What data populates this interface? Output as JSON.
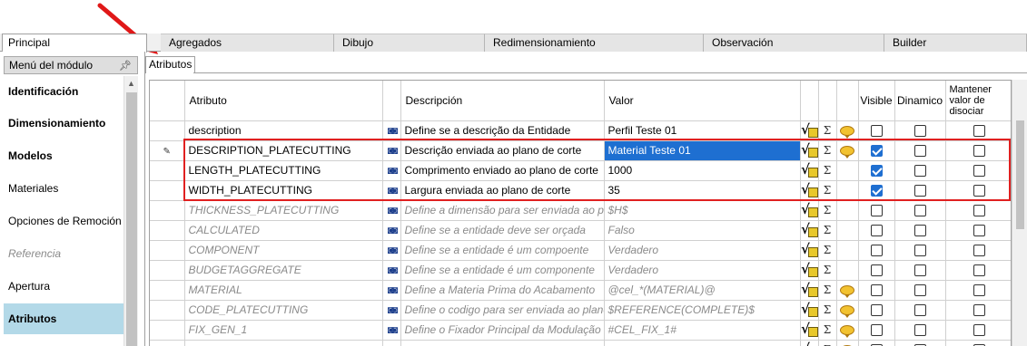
{
  "tabs": [
    {
      "label": "Principal",
      "active": true
    },
    {
      "label": "Agregados"
    },
    {
      "label": "Dibujo"
    },
    {
      "label": "Redimensionamiento"
    },
    {
      "label": "Observación"
    },
    {
      "label": "Builder"
    }
  ],
  "module_menu": {
    "header": "Menú del módulo",
    "items": [
      {
        "label": "Identificación",
        "style": "bold"
      },
      {
        "label": "Dimensionamiento",
        "style": "bold"
      },
      {
        "label": "Modelos",
        "style": "bold"
      },
      {
        "label": "Materiales",
        "style": "normal"
      },
      {
        "label": "Opciones de Remoción",
        "style": "normal"
      },
      {
        "label": "Referencia",
        "style": "disabled"
      },
      {
        "label": "Apertura",
        "style": "normal"
      },
      {
        "label": "Atributos",
        "style": "selected"
      }
    ]
  },
  "subtab": {
    "label": "Atributos"
  },
  "grid": {
    "columns": {
      "atributo": "Atributo",
      "descripcion": "Descripción",
      "valor": "Valor",
      "visible": "Visible",
      "dinamico": "Dinamico",
      "mantener": "Mantener valor de disociar"
    },
    "rows": [
      {
        "atributo": "description",
        "descripcion": "Define se a descrição da Entidade",
        "valor": "Perfil Teste 01",
        "visible": false,
        "dinamico": false,
        "mantener": false,
        "comment": true,
        "inherited": false,
        "editing": false
      },
      {
        "atributo": "DESCRIPTION_PLATECUTTING",
        "descripcion": "Descrição enviada ao plano de corte",
        "valor": "Material Teste 01",
        "visible": true,
        "dinamico": false,
        "mantener": false,
        "comment": true,
        "inherited": false,
        "editing": true
      },
      {
        "atributo": "LENGTH_PLATECUTTING",
        "descripcion": "Comprimento enviado ao plano de corte",
        "valor": "1000",
        "visible": true,
        "dinamico": false,
        "mantener": false,
        "comment": false,
        "inherited": false,
        "editing": false
      },
      {
        "atributo": "WIDTH_PLATECUTTING",
        "descripcion": "Largura enviada ao plano de corte",
        "valor": "35",
        "visible": true,
        "dinamico": false,
        "mantener": false,
        "comment": false,
        "inherited": false,
        "editing": false
      },
      {
        "atributo": "THICKNESS_PLATECUTTING",
        "descripcion": "Define a dimensão para ser enviada ao plan",
        "valor": "$H$",
        "visible": false,
        "dinamico": false,
        "mantener": false,
        "comment": false,
        "inherited": true,
        "editing": false
      },
      {
        "atributo": "CALCULATED",
        "descripcion": "Define se a entidade deve ser orçada",
        "valor": "Falso",
        "visible": false,
        "dinamico": false,
        "mantener": false,
        "comment": false,
        "inherited": true,
        "editing": false
      },
      {
        "atributo": "COMPONENT",
        "descripcion": "Define se a entidade é um compoente",
        "valor": "Verdadero",
        "visible": false,
        "dinamico": false,
        "mantener": false,
        "comment": false,
        "inherited": true,
        "editing": false
      },
      {
        "atributo": "BUDGETAGGREGATE",
        "descripcion": "Define se a entidade é um componente",
        "valor": "Verdadero",
        "visible": false,
        "dinamico": false,
        "mantener": false,
        "comment": false,
        "inherited": true,
        "editing": false
      },
      {
        "atributo": "MATERIAL",
        "descripcion": "Define a Materia Prima do Acabamento",
        "valor": "@cel_*(MATERIAL)@",
        "visible": false,
        "dinamico": false,
        "mantener": false,
        "comment": true,
        "inherited": true,
        "editing": false
      },
      {
        "atributo": "CODE_PLATECUTTING",
        "descripcion": "Define o codigo para ser enviada ao plano",
        "valor": "$REFERENCE(COMPLETE)$",
        "visible": false,
        "dinamico": false,
        "mantener": false,
        "comment": true,
        "inherited": true,
        "editing": false
      },
      {
        "atributo": "FIX_GEN_1",
        "descripcion": "Define o Fixador Principal da Modulação",
        "valor": "#CEL_FIX_1#",
        "visible": false,
        "dinamico": false,
        "mantener": false,
        "comment": true,
        "inherited": true,
        "editing": false
      },
      {
        "atributo": "",
        "descripcion": "",
        "valor": "",
        "visible": false,
        "dinamico": false,
        "mantener": false,
        "comment": true,
        "inherited": true,
        "editing": false
      }
    ]
  },
  "icons": {
    "search": "binoculars-icon",
    "formula": "formula-icon",
    "sum": "sigma-icon",
    "comment": "comment-bubble-icon",
    "pin": "pin-icon"
  },
  "colors": {
    "selection": "#1e6fd1",
    "menu_selected": "#b3d9e8",
    "highlight_border": "#e02020",
    "inherited_text": "#8a8a8a"
  }
}
